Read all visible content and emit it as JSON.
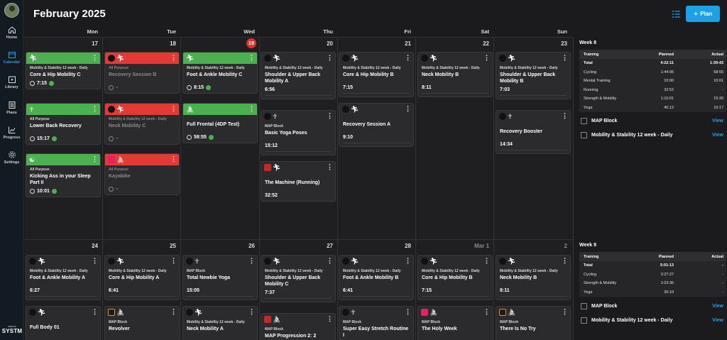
{
  "header": {
    "title": "February 2025",
    "plan_label": "Plan"
  },
  "nav": [
    {
      "label": "Home",
      "icon": "home-icon"
    },
    {
      "label": "Calendar",
      "icon": "calendar-icon"
    },
    {
      "label": "Library",
      "icon": "library-icon"
    },
    {
      "label": "Plans",
      "icon": "plans-icon"
    },
    {
      "label": "Progress",
      "icon": "progress-icon"
    },
    {
      "label": "Settings",
      "icon": "settings-icon"
    }
  ],
  "brand": {
    "top": "wahoo",
    "name": "SYSTM"
  },
  "days": [
    "Mon",
    "Tue",
    "Wed",
    "Thu",
    "Fri",
    "Sat",
    "Sun"
  ],
  "week1_dates": [
    "17",
    "18",
    "19",
    "20",
    "21",
    "22",
    "23"
  ],
  "week2_dates": [
    "24",
    "25",
    "26",
    "27",
    "28",
    "Mar 1",
    "2"
  ],
  "today_index": 2,
  "cards": {
    "c1": {
      "sub": "Mobility & Stability 12 week - Daily",
      "name": "Core & Hip Mobility C",
      "dur": "7:15"
    },
    "c2": {
      "sub": "All Purpose",
      "name": "Lower Back Recovery",
      "dur": "15:17"
    },
    "c3": {
      "sub": "All Purpose",
      "name": "Kicking Ass in your Sleep Part II",
      "dur": "10:01"
    },
    "c4": {
      "sub": "All Purpose",
      "name": "Recovery Session B",
      "dur": "–"
    },
    "c5": {
      "sub": "Mobility & Stability 12 week - Daily",
      "name": "Neck Mobility C",
      "dur": "–"
    },
    "c6": {
      "sub": "All Purpose",
      "name": "Kayabike",
      "dur": "–"
    },
    "c7": {
      "sub": "Mobility & Stability 12 week - Daily",
      "name": "Foot & Ankle Mobility C",
      "dur": "8:15"
    },
    "c8": {
      "name": "Full Frontal (4DP Test)",
      "dur": "58:55"
    },
    "c9": {
      "sub": "Mobility & Stability 12 week - Daily",
      "name": "Shoulder & Upper Back Mobility A",
      "dur": "6:56"
    },
    "c10": {
      "sub": "MAP Block",
      "name": "Basic Yoga Poses",
      "dur": "15:12"
    },
    "c11": {
      "name": "The Machine (Running)",
      "dur": "32:52"
    },
    "c12": {
      "sub": "Mobility & Stability 12 week - Daily",
      "name": "Core & Hip Mobility B",
      "dur": "7:15"
    },
    "c13": {
      "name": "Recovery Session A",
      "dur": "9:10"
    },
    "c14": {
      "sub": "Mobility & Stability 12 week - Daily",
      "name": "Neck Mobility B",
      "dur": "8:11"
    },
    "c15": {
      "sub": "Mobility & Stability 12 week - Daily",
      "name": "Shoulder & Upper Back Mobility B",
      "dur": "7:03"
    },
    "c16": {
      "name": "Recovery Booster",
      "dur": "14:34"
    },
    "d1": {
      "sub": "Mobility & Stability 12 week - Daily",
      "name": "Foot & Ankle Mobility A",
      "dur": "6:27"
    },
    "d2": {
      "name": "Full Body 01",
      "dur": ""
    },
    "d3": {
      "sub": "Mobility & Stability 12 week - Daily",
      "name": "Core & Hip Mobility A",
      "dur": "6:41"
    },
    "d4": {
      "sub": "MAP Block",
      "name": "Revolver"
    },
    "d5": {
      "sub": "MAP Block",
      "name": "Total Newbie Yoga",
      "dur": "15:05"
    },
    "d6": {
      "sub": "Mobility & Stability 12 week - Daily",
      "name": "Neck Mobility A"
    },
    "d7": {
      "sub": "Mobility & Stability 12 week - Daily",
      "name": "Shoulder & Upper Back Mobility C",
      "dur": "7:37"
    },
    "d8": {
      "sub": "MAP Block",
      "name": "MAP Progression 2: 2"
    },
    "d9": {
      "sub": "Mobility & Stability 12 week - Daily",
      "name": "Foot & Ankle Mobility B",
      "dur": "6:41"
    },
    "d10": {
      "sub": "MAP Block",
      "name": "Super Easy Stretch Routine I"
    },
    "d11": {
      "sub": "Mobility & Stability 12 week - Daily",
      "name": "Core & Hip Mobility B",
      "dur": "7:15"
    },
    "d12": {
      "sub": "MAP Block",
      "name": "The Holy Week"
    },
    "d13": {
      "sub": "Mobility & Stability 12 week - Daily",
      "name": "Neck Mobility B",
      "dur": "8:11"
    },
    "d14": {
      "sub": "MAP Block",
      "name": "There Is No Try"
    }
  },
  "week8": {
    "title": "Week 8",
    "head": {
      "c1": "Training",
      "c2": "Planned",
      "c3": "Actual"
    },
    "rows": [
      {
        "c1": "Total",
        "c2": "4:22:11",
        "c3": "1:39:43"
      },
      {
        "c1": "Cycling",
        "c2": "1:44:06",
        "c3": "58:55"
      },
      {
        "c1": "Mental Training",
        "c2": "10:00",
        "c3": "10:01"
      },
      {
        "c1": "Running",
        "c2": "32:52",
        "c3": "-"
      },
      {
        "c1": "Strength & Mobility",
        "c2": "1:10:01",
        "c3": "15:30"
      },
      {
        "c1": "Yoga",
        "c2": "45:12",
        "c3": "15:17"
      }
    ],
    "plans": [
      {
        "name": "MAP Block",
        "view": "View"
      },
      {
        "name": "Mobility & Stability 12 week - Daily",
        "view": "View"
      }
    ]
  },
  "week9": {
    "title": "Week 9",
    "head": {
      "c1": "Training",
      "c2": "Planned",
      "c3": "Actual"
    },
    "rows": [
      {
        "c1": "Total",
        "c2": "5:01:13",
        "c3": "-"
      },
      {
        "c1": "Cycling",
        "c2": "3:27:27",
        "c3": "-"
      },
      {
        "c1": "Strength & Mobility",
        "c2": "1:03:36",
        "c3": "-"
      },
      {
        "c1": "Yoga",
        "c2": "30:10",
        "c3": "-"
      }
    ],
    "plans": [
      {
        "name": "MAP Block",
        "view": "View"
      },
      {
        "name": "Mobility & Stability 12 week - Daily",
        "view": "View"
      }
    ]
  }
}
